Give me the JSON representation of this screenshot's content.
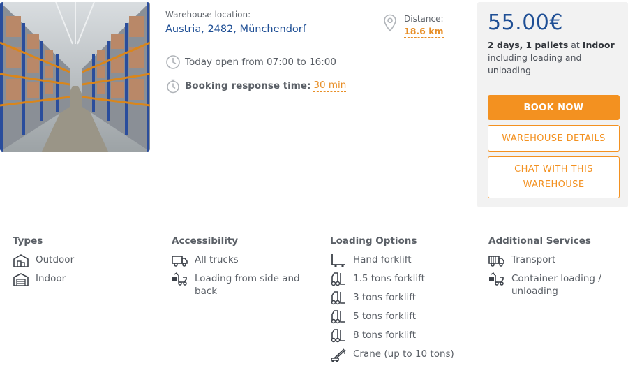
{
  "listing": {
    "location_label": "Warehouse location:",
    "location_value": "Austria, 2482, Münchendorf",
    "opening_hours": "Today open from 07:00 to 16:00",
    "response_label": "Booking response time:",
    "response_value": "30 min",
    "distance_label": "Distance:",
    "distance_value": "18.6 km"
  },
  "pricing": {
    "price": "55.00€",
    "days": "2 days,",
    "pallets": "1 pallets",
    "at": "at",
    "storage": "Indoor",
    "note": "including loading and unloading",
    "book_label": "BOOK NOW",
    "details_label": "WAREHOUSE DETAILS",
    "chat_label": "CHAT WITH THIS WAREHOUSE"
  },
  "features": {
    "types": {
      "title": "Types",
      "items": [
        {
          "label": "Outdoor",
          "icon": "outdoor-warehouse-icon"
        },
        {
          "label": "Indoor",
          "icon": "indoor-warehouse-icon"
        }
      ]
    },
    "accessibility": {
      "title": "Accessibility",
      "items": [
        {
          "label": "All trucks",
          "icon": "truck-icon"
        },
        {
          "label": "Loading from side and back",
          "icon": "side-loading-icon"
        }
      ]
    },
    "loading": {
      "title": "Loading Options",
      "items": [
        {
          "label": "Hand forklift",
          "icon": "hand-forklift-icon"
        },
        {
          "label": "1.5 tons forklift",
          "icon": "forklift-icon"
        },
        {
          "label": "3 tons forklift",
          "icon": "forklift-icon"
        },
        {
          "label": "5 tons forklift",
          "icon": "forklift-icon"
        },
        {
          "label": "8 tons forklift",
          "icon": "forklift-icon"
        },
        {
          "label": "Crane (up to 10 tons)",
          "icon": "crane-icon"
        }
      ]
    },
    "services": {
      "title": "Additional Services",
      "items": [
        {
          "label": "Transport",
          "icon": "transport-truck-icon"
        },
        {
          "label": "Container loading / unloading",
          "icon": "container-loading-icon"
        }
      ]
    }
  },
  "colors": {
    "accent": "#f39120",
    "brand_blue": "#1f4f95",
    "text": "#5a5f66"
  }
}
